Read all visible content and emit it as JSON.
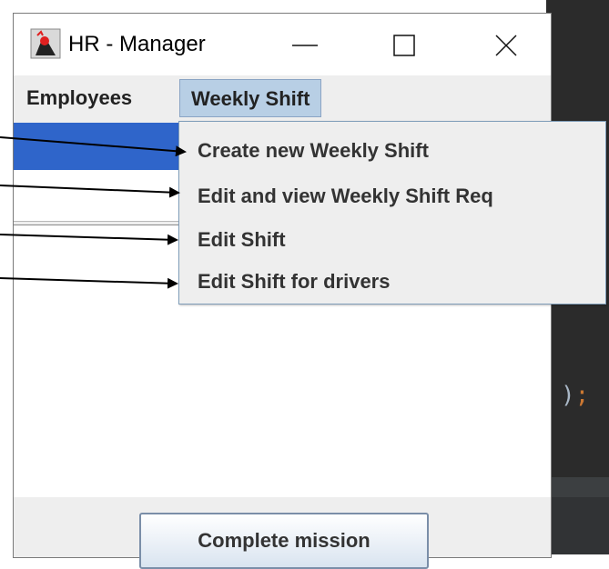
{
  "window": {
    "title": "HR - Manager",
    "icons": {
      "app": "java-duke-icon",
      "minimize": "minimize-icon",
      "maximize": "maximize-icon",
      "close": "close-icon"
    }
  },
  "menubar": {
    "items": [
      {
        "label": "Employees"
      },
      {
        "label": "Weekly Shift",
        "open": true
      }
    ]
  },
  "dropdown": {
    "items": [
      {
        "label": "Create new Weekly Shift"
      },
      {
        "label": "Edit and view Weekly Shift Req"
      },
      {
        "label": "Edit Shift"
      },
      {
        "label": "Edit Shift for drivers"
      }
    ]
  },
  "footer": {
    "button_label": "Complete mission"
  },
  "background_code": {
    "text": ")",
    "semicolon": ";"
  },
  "colors": {
    "selection": "#2f65ca",
    "menu_highlight": "#b8cfe5",
    "ide_background": "#2b2b2b"
  }
}
